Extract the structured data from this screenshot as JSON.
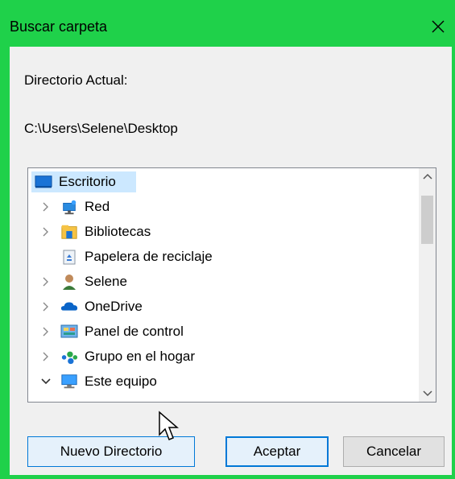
{
  "window": {
    "title": "Buscar carpeta",
    "accent_color": "#1fd14a"
  },
  "labels": {
    "current_dir_label": "Directorio Actual:",
    "current_path": "C:\\Users\\Selene\\Desktop"
  },
  "tree": {
    "items": [
      {
        "label": "Escritorio",
        "icon": "desktop-icon",
        "selected": true
      },
      {
        "label": "Red",
        "icon": "network-icon"
      },
      {
        "label": "Bibliotecas",
        "icon": "libraries-icon"
      },
      {
        "label": "Papelera de reciclaje",
        "icon": "recycle-bin-icon"
      },
      {
        "label": "Selene",
        "icon": "user-icon"
      },
      {
        "label": "OneDrive",
        "icon": "onedrive-icon"
      },
      {
        "label": "Panel de control",
        "icon": "control-panel-icon"
      },
      {
        "label": "Grupo en el hogar",
        "icon": "homegroup-icon"
      },
      {
        "label": "Este equipo",
        "icon": "computer-icon"
      }
    ]
  },
  "buttons": {
    "new_folder": "Nuevo Directorio",
    "ok": "Aceptar",
    "cancel": "Cancelar"
  }
}
